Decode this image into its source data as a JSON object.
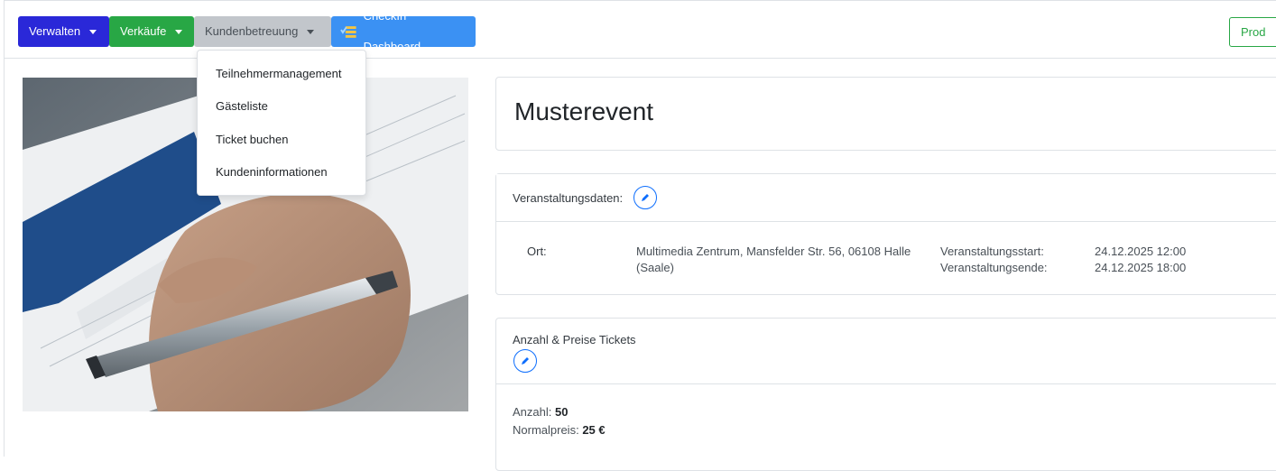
{
  "nav": {
    "verwalten": "Verwalten",
    "verkaeufe": "Verkäufe",
    "kundenbetreuung": "Kundenbetreuung",
    "checkin": "CheckIn Dashboard",
    "prod": "Prod"
  },
  "dropdown": {
    "items": [
      "Teilnehmermanagement",
      "Gästeliste",
      "Ticket buchen",
      "Kundeninformationen"
    ]
  },
  "event": {
    "title": "Musterevent"
  },
  "veranstaltungsdaten": {
    "header": "Veranstaltungsdaten:",
    "ort_label": "Ort:",
    "ort_value_line1": "Multimedia Zentrum, Mansfelder Str. 56, 06108 Halle",
    "ort_value_line2": "(Saale)",
    "start_label": "Veranstaltungsstart:",
    "end_label": "Veranstaltungsende:",
    "start_value": "24.12.2025 12:00",
    "end_value": "24.12.2025 18:00"
  },
  "tickets": {
    "header": "Anzahl & Preise Tickets",
    "anzahl_label": "Anzahl:",
    "anzahl_value": "50",
    "preis_label": "Normalpreis:",
    "preis_value": "25 €"
  },
  "colors": {
    "verwalten": "#2a28d8",
    "verkaeufe": "#28a745",
    "kundenbetreuung": "#c2c6cb",
    "checkin": "#3b91f3",
    "edit": "#0d6efd"
  }
}
